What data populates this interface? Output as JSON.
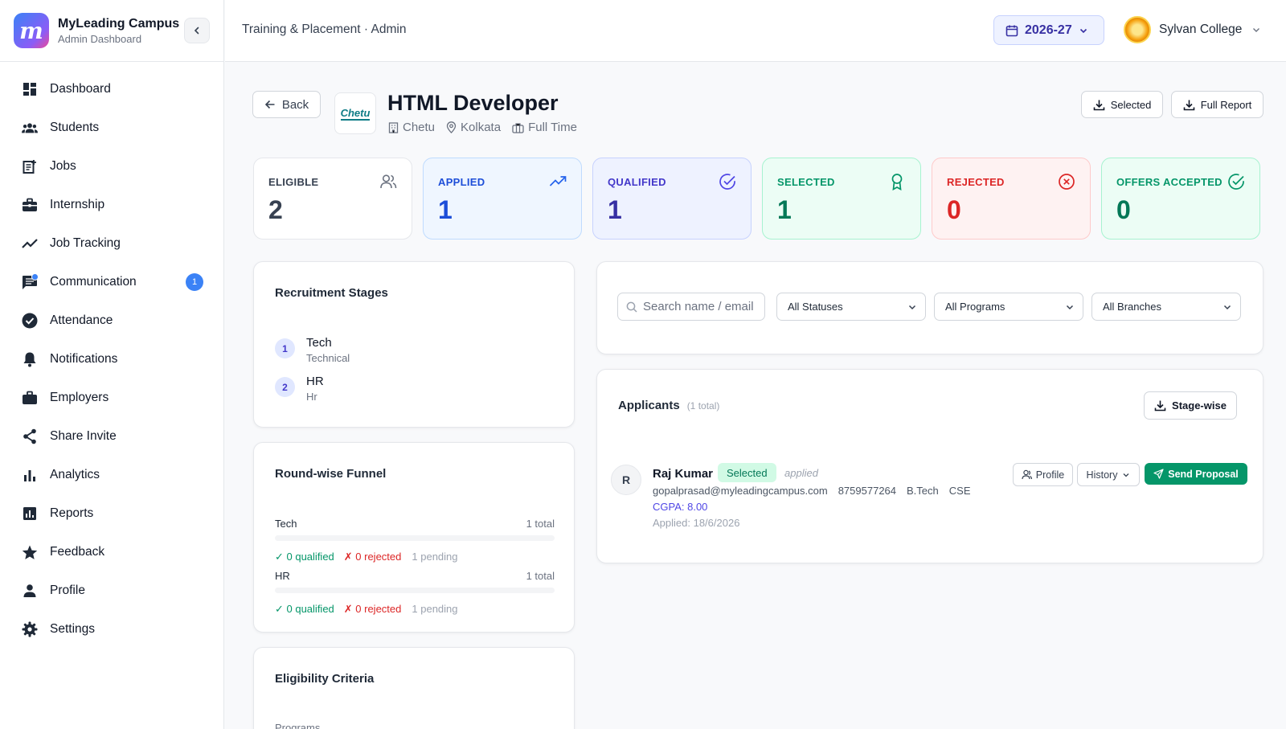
{
  "brand": {
    "logo_letter": "m",
    "name": "MyLeading Campus",
    "subtitle": "Admin Dashboard"
  },
  "sidebar": {
    "items": [
      {
        "label": "Dashboard",
        "icon": "dashboard-icon"
      },
      {
        "label": "Students",
        "icon": "students-icon"
      },
      {
        "label": "Jobs",
        "icon": "jobs-icon"
      },
      {
        "label": "Internship",
        "icon": "briefcase-icon"
      },
      {
        "label": "Job Tracking",
        "icon": "trending-icon"
      },
      {
        "label": "Communication",
        "icon": "chat-icon",
        "badge": "1"
      },
      {
        "label": "Attendance",
        "icon": "check-circle-icon"
      },
      {
        "label": "Notifications",
        "icon": "bell-icon"
      },
      {
        "label": "Employers",
        "icon": "work-icon"
      },
      {
        "label": "Share Invite",
        "icon": "share-icon"
      },
      {
        "label": "Analytics",
        "icon": "bar-chart-icon"
      },
      {
        "label": "Reports",
        "icon": "report-icon"
      },
      {
        "label": "Feedback",
        "icon": "star-icon"
      },
      {
        "label": "Profile",
        "icon": "person-icon"
      },
      {
        "label": "Settings",
        "icon": "gear-icon"
      }
    ]
  },
  "topbar": {
    "breadcrumb": "Training & Placement · Admin",
    "academic_year": "2026-27",
    "college_name": "Sylvan College"
  },
  "job": {
    "back_label": "Back",
    "company_logo_text": "Chetu",
    "title": "HTML Developer",
    "company": "Chetu",
    "location": "Kolkata",
    "type": "Full Time",
    "export_selected_label": "Selected",
    "full_report_label": "Full Report"
  },
  "stats": [
    {
      "label": "ELIGIBLE",
      "value": "2",
      "icon": "users-icon"
    },
    {
      "label": "APPLIED",
      "value": "1",
      "icon": "trending-up-icon"
    },
    {
      "label": "QUALIFIED",
      "value": "1",
      "icon": "check-circle-icon"
    },
    {
      "label": "SELECTED",
      "value": "1",
      "icon": "award-icon"
    },
    {
      "label": "REJECTED",
      "value": "0",
      "icon": "x-circle-icon"
    },
    {
      "label": "OFFERS ACCEPTED",
      "value": "0",
      "icon": "check-circle-icon"
    }
  ],
  "colors": {
    "eligible": "#374151",
    "applied": "#1d4ed8",
    "qualified": "#3730a3",
    "selected": "#047857",
    "rejected": "#dc2626",
    "offers": "#047857"
  },
  "recruitment_stages": {
    "title": "Recruitment Stages",
    "stages": [
      {
        "num": "1",
        "name": "Tech",
        "sub": "Technical"
      },
      {
        "num": "2",
        "name": "HR",
        "sub": "Hr"
      }
    ]
  },
  "funnel": {
    "title": "Round-wise Funnel",
    "rounds": [
      {
        "name": "Tech",
        "total": "1 total",
        "qualified": "✓ 0 qualified",
        "rejected": "✗ 0 rejected",
        "pending": "1 pending"
      },
      {
        "name": "HR",
        "total": "1 total",
        "qualified": "✓ 0 qualified",
        "rejected": "✗ 0 rejected",
        "pending": "1 pending"
      }
    ]
  },
  "eligibility": {
    "title": "Eligibility Criteria",
    "programs_label": "Programs"
  },
  "filters": {
    "search_placeholder": "Search name / email",
    "status": "All Statuses",
    "programs": "All Programs",
    "branches": "All Branches"
  },
  "applicants": {
    "title": "Applicants",
    "count": "(1 total)",
    "stagewise_label": "Stage-wise",
    "list": [
      {
        "initial": "R",
        "name": "Raj Kumar",
        "badge": "Selected",
        "status": "applied",
        "email": "gopalprasad@myleadingcampus.com",
        "phone": "8759577264",
        "program": "B.Tech",
        "branch": "CSE",
        "cgpa": "CGPA: 8.00",
        "applied": "Applied: 18/6/2026",
        "profile_label": "Profile",
        "history_label": "History",
        "proposal_label": "Send Proposal"
      }
    ]
  }
}
